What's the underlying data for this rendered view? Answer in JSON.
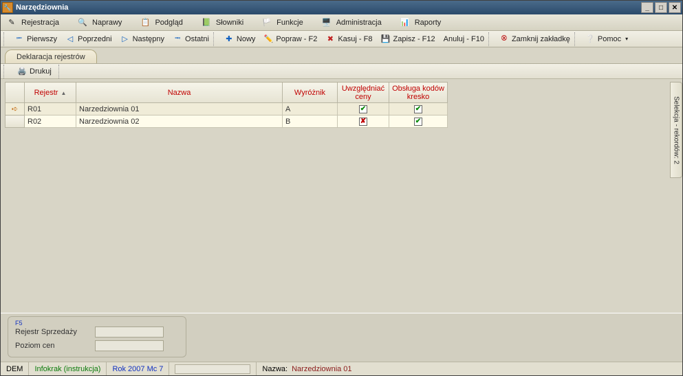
{
  "title": "Narzędziownia",
  "menu": {
    "rejestracja": "Rejestracja",
    "naprawy": "Naprawy",
    "podglad": "Podgląd",
    "slowniki": "Słowniki",
    "funkcje": "Funkcje",
    "administracja": "Administracja",
    "raporty": "Raporty"
  },
  "toolbar": {
    "pierwszy": "Pierwszy",
    "poprzedni": "Poprzedni",
    "nastepny": "Następny",
    "ostatni": "Ostatni",
    "nowy": "Nowy",
    "popraw": "Popraw - F2",
    "kasuj": "Kasuj - F8",
    "zapisz": "Zapisz - F12",
    "anuluj": "Anuluj - F10",
    "zamknij": "Zamknij zakładkę",
    "pomoc": "Pomoc"
  },
  "tab_label": "Deklaracja rejestrów",
  "print": "Drukuj",
  "columns": {
    "rejestr": "Rejestr",
    "nazwa": "Nazwa",
    "wyroznik": "Wyróżnik",
    "uwzgl": "Uwzględniać ceny",
    "obsluga": "Obsługa kodów kresko"
  },
  "rows": [
    {
      "rejestr": "R01",
      "nazwa": "Narzedziownia 01",
      "wyroznik": "A",
      "uwzgl": true,
      "obsluga": true,
      "selected": true
    },
    {
      "rejestr": "R02",
      "nazwa": "Narzedziownia 02",
      "wyroznik": "B",
      "uwzgl": false,
      "obsluga": true,
      "selected": false
    }
  ],
  "sidevtab": "Selekcja - rekordów: 2",
  "form": {
    "f5": "F5",
    "rejestr_label": "Rejestr Sprzedaży",
    "poziom_label": "Poziom cen"
  },
  "status": {
    "dem": "DEM",
    "infokrak": "Infokrak (instrukcja)",
    "rok": "Rok 2007  Mc 7",
    "nazwa_label": "Nazwa:",
    "nazwa_value": "Narzedziownia 01"
  }
}
